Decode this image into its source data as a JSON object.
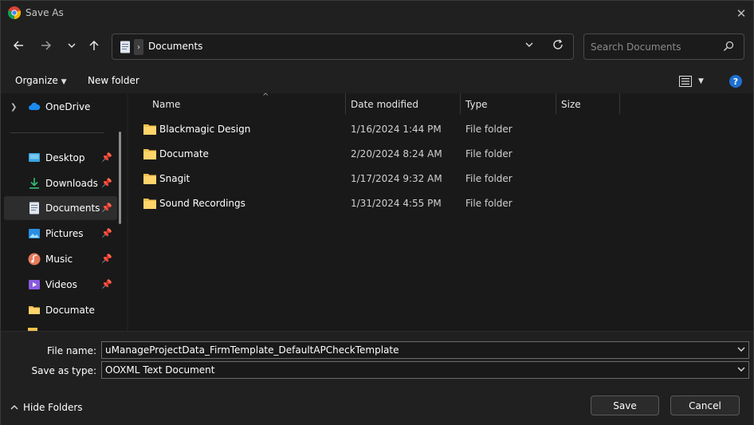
{
  "window": {
    "title": "Save As"
  },
  "nav": {
    "address": "Documents",
    "search_placeholder": "Search Documents"
  },
  "toolbar": {
    "organize": "Organize",
    "new_folder": "New folder"
  },
  "sidebar": {
    "items": [
      {
        "label": "OneDrive",
        "pinned": false,
        "icon": "cloud-icon"
      },
      {
        "label": "Desktop",
        "pinned": true,
        "icon": "desktop-icon"
      },
      {
        "label": "Downloads",
        "pinned": true,
        "icon": "download-icon"
      },
      {
        "label": "Documents",
        "pinned": true,
        "icon": "document-icon",
        "selected": true
      },
      {
        "label": "Pictures",
        "pinned": true,
        "icon": "pictures-icon"
      },
      {
        "label": "Music",
        "pinned": true,
        "icon": "music-icon"
      },
      {
        "label": "Videos",
        "pinned": true,
        "icon": "videos-icon"
      },
      {
        "label": "Documate",
        "pinned": false,
        "icon": "folder-icon"
      }
    ]
  },
  "columns": {
    "name": "Name",
    "date": "Date modified",
    "type": "Type",
    "size": "Size"
  },
  "files": [
    {
      "name": "Blackmagic Design",
      "date": "1/16/2024 1:44 PM",
      "type": "File folder"
    },
    {
      "name": "Documate",
      "date": "2/20/2024 8:24 AM",
      "type": "File folder"
    },
    {
      "name": "Snagit",
      "date": "1/17/2024 9:32 AM",
      "type": "File folder"
    },
    {
      "name": "Sound Recordings",
      "date": "1/31/2024 4:55 PM",
      "type": "File folder"
    }
  ],
  "form": {
    "file_name_label": "File name:",
    "file_name_value": "uManageProjectData_FirmTemplate_DefaultAPCheckTemplate",
    "save_type_label": "Save as type:",
    "save_type_value": "OOXML Text Document"
  },
  "buttons": {
    "save": "Save",
    "cancel": "Cancel",
    "hide_folders": "Hide Folders"
  },
  "colors": {
    "background": "#202020",
    "panel": "#191919",
    "accent": "#1e6fd0",
    "folder": "#f2c14e"
  }
}
